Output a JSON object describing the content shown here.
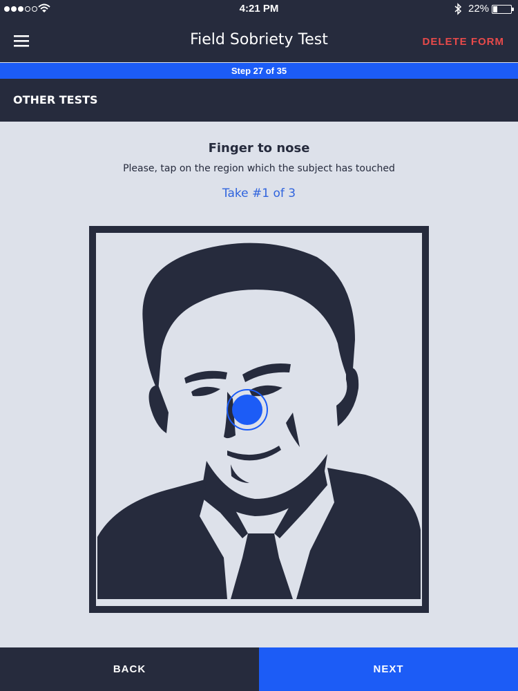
{
  "status_bar": {
    "time": "4:21 PM",
    "battery_percent": "22%",
    "battery_level": 0.22,
    "signal_bars_filled": 3,
    "signal_bars_total": 5,
    "icons": [
      "wifi-icon",
      "bluetooth-icon",
      "battery-icon"
    ]
  },
  "nav": {
    "title": "Field Sobriety Test",
    "delete_label": "DELETE FORM",
    "menu_icon": "hamburger-menu-icon"
  },
  "step": {
    "label": "Step 27 of 35",
    "current": 27,
    "total": 35
  },
  "section": {
    "title": "OTHER TESTS"
  },
  "test": {
    "title": "Finger to nose",
    "instruction": "Please, tap on the region which the subject has touched",
    "take_label": "Take #1 of 3"
  },
  "footer": {
    "back_label": "BACK",
    "next_label": "NEXT"
  },
  "colors": {
    "dark": "#262b3d",
    "accent": "#1c5cf6",
    "danger": "#e84a4a",
    "background": "#dde1ea",
    "link": "#2f63dd"
  }
}
